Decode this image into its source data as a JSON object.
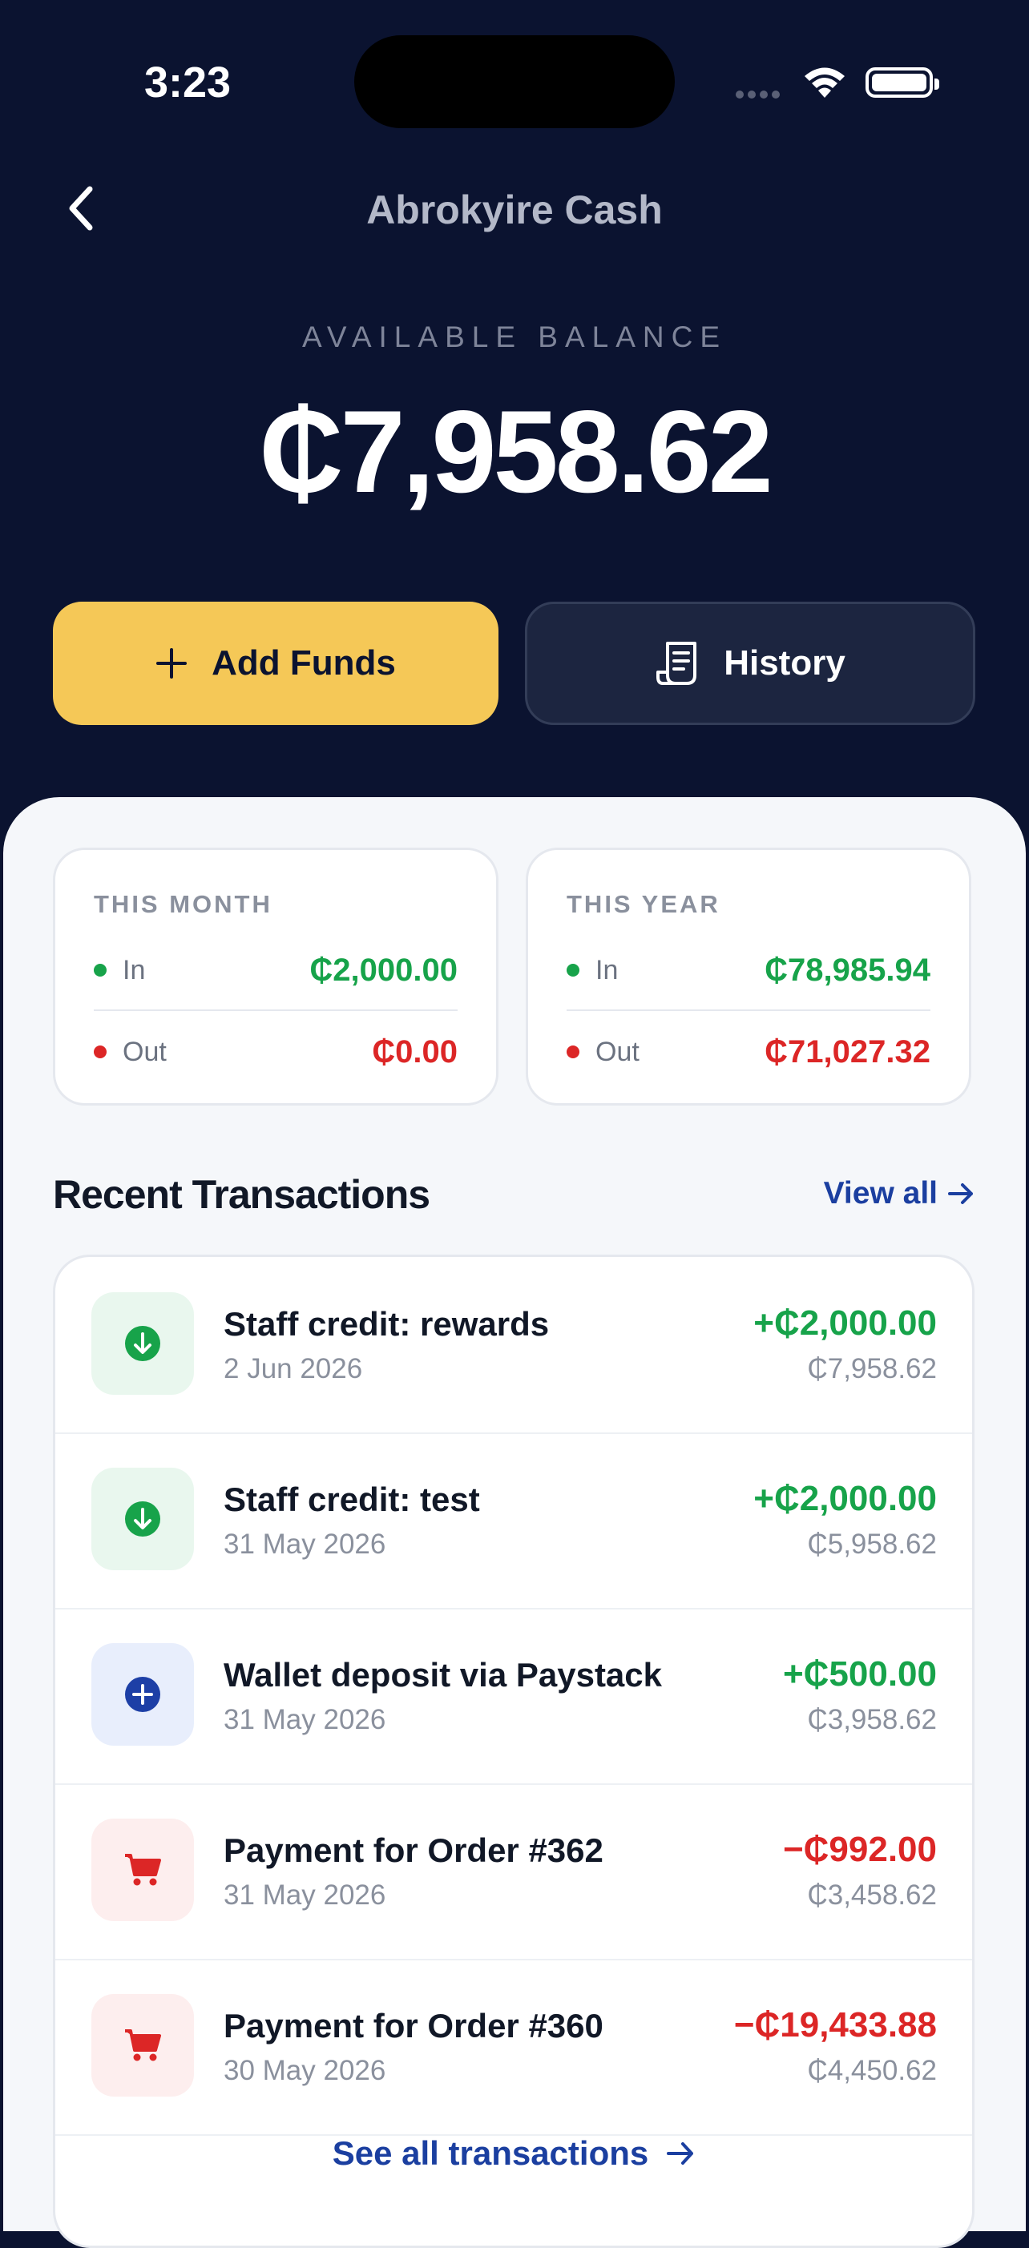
{
  "status_bar": {
    "time": "3:23"
  },
  "header": {
    "title": "Abrokyire Cash"
  },
  "balance": {
    "label": "AVAILABLE BALANCE",
    "amount": "₵7,958.62"
  },
  "actions": {
    "add_funds_label": "Add Funds",
    "history_label": "History"
  },
  "summary": {
    "month": {
      "title": "THIS MONTH",
      "in_label": "In",
      "in_value": "₵2,000.00",
      "out_label": "Out",
      "out_value": "₵0.00"
    },
    "year": {
      "title": "THIS YEAR",
      "in_label": "In",
      "in_value": "₵78,985.94",
      "out_label": "Out",
      "out_value": "₵71,027.32"
    }
  },
  "recent": {
    "title": "Recent Transactions",
    "view_all_label": "View all",
    "see_all_label": "See all transactions",
    "transactions": [
      {
        "title": "Staff credit: rewards",
        "date": "2 Jun 2026",
        "amount": "+₵2,000.00",
        "balance": "₵7,958.62",
        "kind": "credit",
        "icon": "arrow-down-circle-icon"
      },
      {
        "title": "Staff credit: test",
        "date": "31 May 2026",
        "amount": "+₵2,000.00",
        "balance": "₵5,958.62",
        "kind": "credit",
        "icon": "arrow-down-circle-icon"
      },
      {
        "title": "Wallet deposit via Paystack",
        "date": "31 May 2026",
        "amount": "+₵500.00",
        "balance": "₵3,958.62",
        "kind": "deposit",
        "icon": "plus-circle-icon"
      },
      {
        "title": "Payment for Order #362",
        "date": "31 May 2026",
        "amount": "−₵992.00",
        "balance": "₵3,458.62",
        "kind": "payment",
        "icon": "cart-icon"
      },
      {
        "title": "Payment for Order #360",
        "date": "30 May 2026",
        "amount": "−₵19,433.88",
        "balance": "₵4,450.62",
        "kind": "payment",
        "icon": "cart-icon"
      }
    ]
  },
  "colors": {
    "background": "#0b1330",
    "accent": "#f5c857",
    "positive": "#17a34a",
    "negative": "#dc2626",
    "link": "#1b3fa0"
  }
}
